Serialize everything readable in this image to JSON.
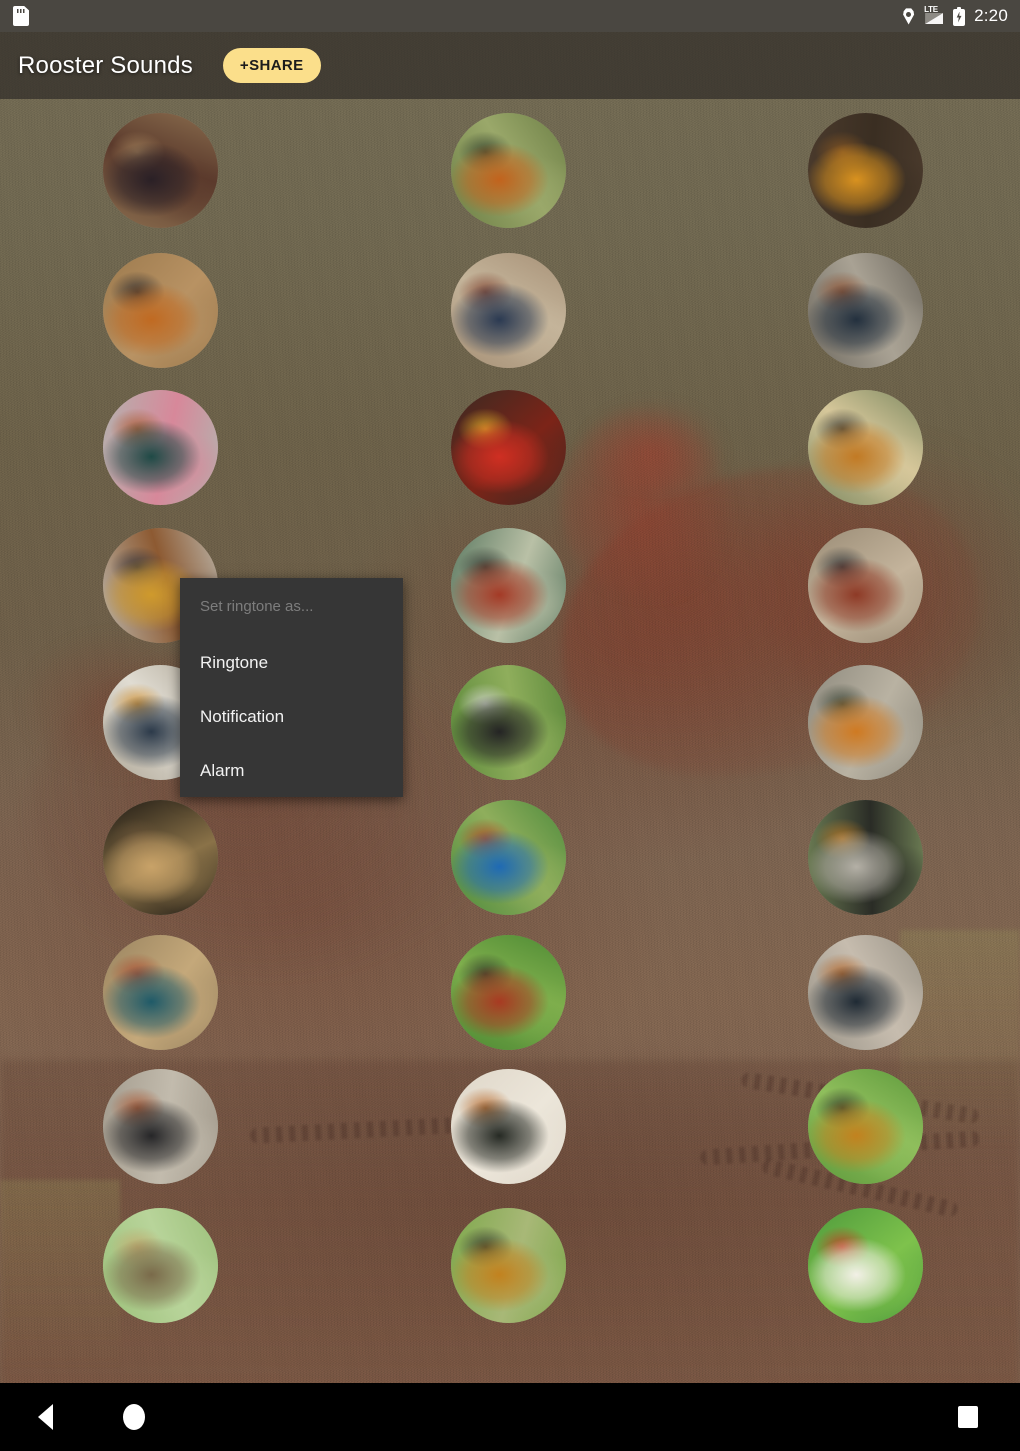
{
  "status_bar": {
    "left_icon": "sd-card-icon",
    "icons": [
      "location-icon",
      "lte-signal-icon",
      "battery-charging-icon"
    ],
    "signal_label": "LTE",
    "time": "2:20"
  },
  "app_bar": {
    "title": "Rooster Sounds",
    "share_label": "+SHARE",
    "share_color": "#fbdf8b"
  },
  "menu": {
    "header": "Set ringtone as...",
    "items": [
      {
        "label": "Ringtone"
      },
      {
        "label": "Notification"
      },
      {
        "label": "Alarm"
      }
    ]
  },
  "nav_bar": {
    "back": "back-triangle-icon",
    "home": "home-circle-icon",
    "recents": "recents-square-icon"
  },
  "grid": {
    "columns": 3,
    "rows": 10,
    "circle_diameter": 115,
    "column_centers": [
      160,
      508,
      865
    ],
    "row_centers": [
      170,
      310,
      447,
      585,
      722,
      857,
      992,
      1126,
      1265
    ],
    "items": [
      {
        "id": "sound-1",
        "col": 1,
        "row": 1,
        "alt": "black-and-red-rooster-pecking-on-dirt",
        "c1": "#8a6d4e",
        "c2": "#2a2026",
        "c3": "#a8875f",
        "c4": "#5b3a2c"
      },
      {
        "id": "sound-2",
        "col": 2,
        "row": 1,
        "alt": "orange-rooster-standing-in-grass",
        "c1": "#6d7f46",
        "c2": "#c2631d",
        "c3": "#2d3a2a",
        "c4": "#9aa86a"
      },
      {
        "id": "sound-3",
        "col": 3,
        "row": 1,
        "alt": "golden-rooster-crowing-close-up",
        "c1": "#4a3a2c",
        "c2": "#d9921f",
        "c3": "#8e5a22",
        "c4": "#3a2e22"
      },
      {
        "id": "sound-4",
        "col": 1,
        "row": 2,
        "alt": "two-roosters-on-sandy-ground",
        "c1": "#9c7a4e",
        "c2": "#c06a22",
        "c3": "#23242a",
        "c4": "#b89263"
      },
      {
        "id": "sound-5",
        "col": 2,
        "row": 2,
        "alt": "blue-black-rooster-on-path",
        "c1": "#a79177",
        "c2": "#2b3a52",
        "c3": "#7a3a28",
        "c4": "#c4b49a"
      },
      {
        "id": "sound-6",
        "col": 3,
        "row": 2,
        "alt": "rooster-perched-on-log",
        "c1": "#6f6a60",
        "c2": "#23303e",
        "c3": "#8d4a28",
        "c4": "#a9a294"
      },
      {
        "id": "sound-7",
        "col": 1,
        "row": 3,
        "alt": "rooster-on-pink-floor-indoors",
        "c1": "#b4b2ae",
        "c2": "#1f4a46",
        "c3": "#a8572a",
        "c4": "#d7889a"
      },
      {
        "id": "sound-8",
        "col": 2,
        "row": 3,
        "alt": "red-rooster-head-close-up",
        "c1": "#3a2a22",
        "c2": "#cf2f22",
        "c3": "#e6b82a",
        "c4": "#7c2418"
      },
      {
        "id": "sound-9",
        "col": 3,
        "row": 3,
        "alt": "rooster-standing-on-bamboo-rack",
        "c1": "#7f8a62",
        "c2": "#c27a24",
        "c3": "#2b2c2a",
        "c4": "#d6c79a"
      },
      {
        "id": "sound-10",
        "col": 1,
        "row": 4,
        "alt": "rooster-in-front-of-white-wall",
        "c1": "#b9b2a6",
        "c2": "#cf9a2c",
        "c3": "#2a2c36",
        "c4": "#8d5a32"
      },
      {
        "id": "sound-11",
        "col": 2,
        "row": 4,
        "alt": "rooster-near-green-fence",
        "c1": "#5d7a62",
        "c2": "#a43a26",
        "c3": "#2a2f2a",
        "c4": "#b9c0a6"
      },
      {
        "id": "sound-12",
        "col": 3,
        "row": 4,
        "alt": "rooster-walking-on-dirt-yard",
        "c1": "#9a8c76",
        "c2": "#8e3a26",
        "c3": "#22282e",
        "c4": "#c4b49c"
      },
      {
        "id": "sound-13",
        "col": 1,
        "row": 5,
        "alt": "rooster-beside-white-wall-and-bowl",
        "c1": "#b0a898",
        "c2": "#2c3a4a",
        "c3": "#cf8a24",
        "c4": "#e0dcd2"
      },
      {
        "id": "sound-14",
        "col": 2,
        "row": 5,
        "alt": "black-and-white-rooster-in-garden",
        "c1": "#5e8a3c",
        "c2": "#242424",
        "c3": "#d9d9d9",
        "c4": "#8fae5c"
      },
      {
        "id": "sound-15",
        "col": 3,
        "row": 5,
        "alt": "rooster-on-rocky-mound",
        "c1": "#8e8a7e",
        "c2": "#cf7a22",
        "c3": "#2e3a2c",
        "c4": "#b9b2a2"
      },
      {
        "id": "sound-16",
        "col": 1,
        "row": 6,
        "alt": "brown-hen-on-straw",
        "c1": "#1f1a14",
        "c2": "#c8a268",
        "c3": "#6a5438",
        "c4": "#8a7248"
      },
      {
        "id": "sound-17",
        "col": 2,
        "row": 6,
        "alt": "rooster-on-blue-mat-in-yard",
        "c1": "#4e8a3c",
        "c2": "#1f6ab4",
        "c3": "#b4401f",
        "c4": "#8fae5c"
      },
      {
        "id": "sound-18",
        "col": 3,
        "row": 6,
        "alt": "rooster-in-front-of-wire-mesh",
        "c1": "#6a7a52",
        "c2": "#b4b0a6",
        "c3": "#c27a22",
        "c4": "#2a2c26"
      },
      {
        "id": "sound-19",
        "col": 1,
        "row": 7,
        "alt": "rooster-on-wooden-cart",
        "c1": "#9a8460",
        "c2": "#1f5a68",
        "c3": "#a8452a",
        "c4": "#c4a87a"
      },
      {
        "id": "sound-20",
        "col": 2,
        "row": 7,
        "alt": "rooster-on-green-lawn-by-post",
        "c1": "#4e8a34",
        "c2": "#a83a22",
        "c3": "#2a2e26",
        "c4": "#7eae4c"
      },
      {
        "id": "sound-21",
        "col": 3,
        "row": 7,
        "alt": "rooster-on-gravel-path",
        "c1": "#9a9488",
        "c2": "#1f2a34",
        "c3": "#b4601f",
        "c4": "#c6bcae"
      },
      {
        "id": "sound-22",
        "col": 1,
        "row": 8,
        "alt": "rooster-standing-on-gravel",
        "c1": "#a49c8e",
        "c2": "#262628",
        "c3": "#a8502a",
        "c4": "#c2bbad"
      },
      {
        "id": "sound-23",
        "col": 2,
        "row": 8,
        "alt": "rooster-against-pale-wall",
        "c1": "#ded6c8",
        "c2": "#262a24",
        "c3": "#b4601f",
        "c4": "#ece6da"
      },
      {
        "id": "sound-24",
        "col": 3,
        "row": 8,
        "alt": "rooster-on-grass-in-garden",
        "c1": "#5e9a3c",
        "c2": "#c2821f",
        "c3": "#2a2e26",
        "c4": "#8fbe5c"
      },
      {
        "id": "sound-25",
        "col": 1,
        "row": 9,
        "alt": "hen-among-green-leaves",
        "c1": "#9cc07a",
        "c2": "#7a6a4a",
        "c3": "#c4a66a",
        "c4": "#b8d49a"
      },
      {
        "id": "sound-26",
        "col": 2,
        "row": 9,
        "alt": "golden-rooster-on-patchy-grass",
        "c1": "#7ea84c",
        "c2": "#c2821f",
        "c3": "#2a2c26",
        "c4": "#a8b877"
      },
      {
        "id": "sound-27",
        "col": 3,
        "row": 9,
        "alt": "white-rooster-on-green-lawn",
        "c1": "#4e9a3c",
        "c2": "#f2f0e6",
        "c3": "#cf2a1f",
        "c4": "#7ec24c"
      }
    ]
  }
}
